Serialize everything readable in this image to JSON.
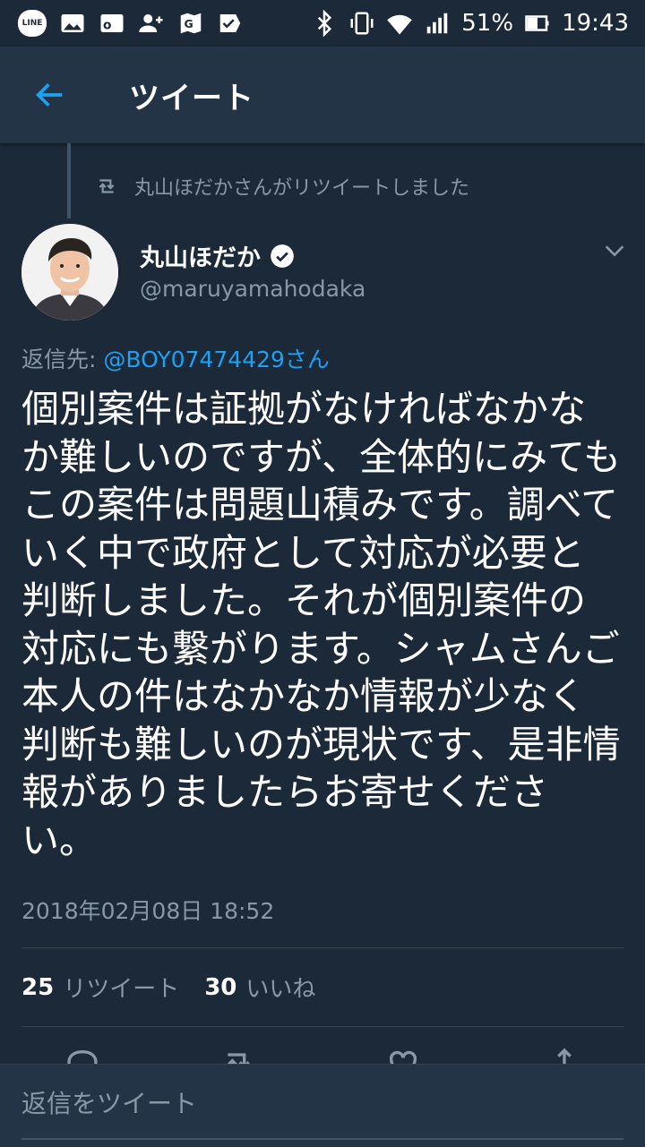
{
  "status_bar": {
    "battery": "51%",
    "time": "19:43",
    "icons": [
      "line-icon",
      "image-icon",
      "outlook-icon",
      "add-contact-icon",
      "maps-icon",
      "checkmark-icon",
      "bluetooth-icon",
      "vibrate-icon",
      "wifi-icon",
      "signal-icon",
      "battery-icon"
    ]
  },
  "header": {
    "title": "ツイート"
  },
  "retweet_notice": "丸山ほだかさんがリツイートしました",
  "tweet": {
    "author_name": "丸山ほだか",
    "author_handle": "@maruyamahodaka",
    "reply_prefix": "返信先: ",
    "reply_mention": "@BOY07474429さん",
    "text": "個別案件は証拠がなければなかなか難しいのですが、全体的にみてもこの案件は問題山積みです。調べていく中で政府として対応が必要と判断しました。それが個別案件の対応にも繋がります。シャムさんご本人の件はなかなか情報が少なく判断も難しいのが現状です、是非情報がありましたらお寄せください。",
    "timestamp": "2018年02月08日 18:52",
    "retweets_count": "25",
    "retweets_label": "リツイート",
    "likes_count": "30",
    "likes_label": "いいね"
  },
  "reply_box": {
    "placeholder": "返信をツイート"
  },
  "colors": {
    "background": "#1c2938",
    "header": "#243447",
    "accent": "#1da1f2",
    "muted_text": "#8899a6"
  }
}
